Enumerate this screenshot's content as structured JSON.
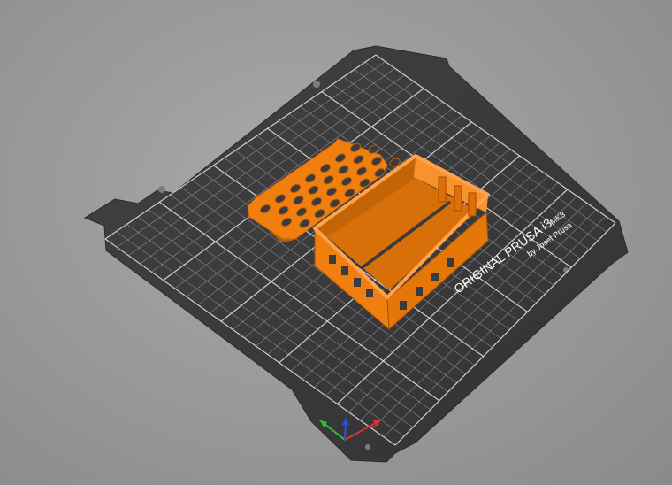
{
  "app": {
    "view": "3D plater",
    "background_color": "#9b9b9b"
  },
  "bed": {
    "plate_color": "#3b3b3d",
    "grid_color": "#e8e8e8",
    "logo": {
      "title": "ORIGINAL PRUSA i3",
      "model": "MK3",
      "byline": "by Josef Prusa"
    }
  },
  "model": {
    "color": "#f07f10",
    "shade_color": "#b85c06",
    "parts": [
      "case-lid",
      "case-base"
    ]
  },
  "axes": {
    "x_color": "#e03030",
    "y_color": "#30c030",
    "z_color": "#3050e0"
  }
}
